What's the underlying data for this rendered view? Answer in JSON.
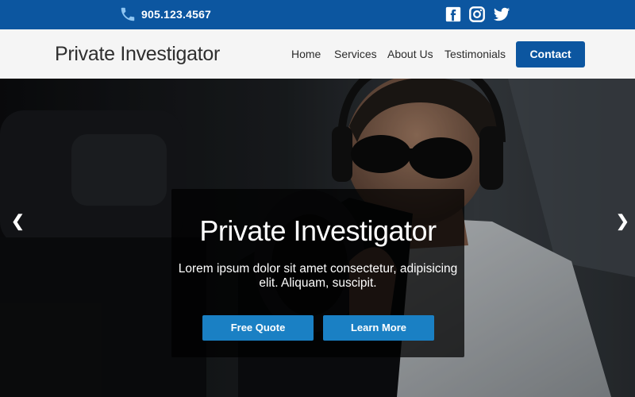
{
  "topbar": {
    "phone_icon": "phone-icon",
    "phone_number": "905.123.4567",
    "social": [
      {
        "name": "facebook",
        "icon": "facebook-icon"
      },
      {
        "name": "instagram",
        "icon": "instagram-icon"
      },
      {
        "name": "twitter",
        "icon": "twitter-icon"
      }
    ],
    "background_color": "#0c56a0"
  },
  "header": {
    "logo_text": "Private Investigator",
    "nav": {
      "home": "Home",
      "services": "Services",
      "about": "About Us",
      "testimonials": "Testimonials"
    },
    "contact_label": "Contact",
    "accent_color": "#0c56a0"
  },
  "hero": {
    "prev_arrow": "❮",
    "next_arrow": "❯",
    "title": "Private Investigator",
    "text": "Lorem ipsum dolor sit amet consectetur, adipisicing elit. Aliquam, suscipit.",
    "buttons": {
      "free_quote": "Free Quote",
      "learn_more": "Learn More"
    },
    "button_color": "#1a80c4"
  }
}
